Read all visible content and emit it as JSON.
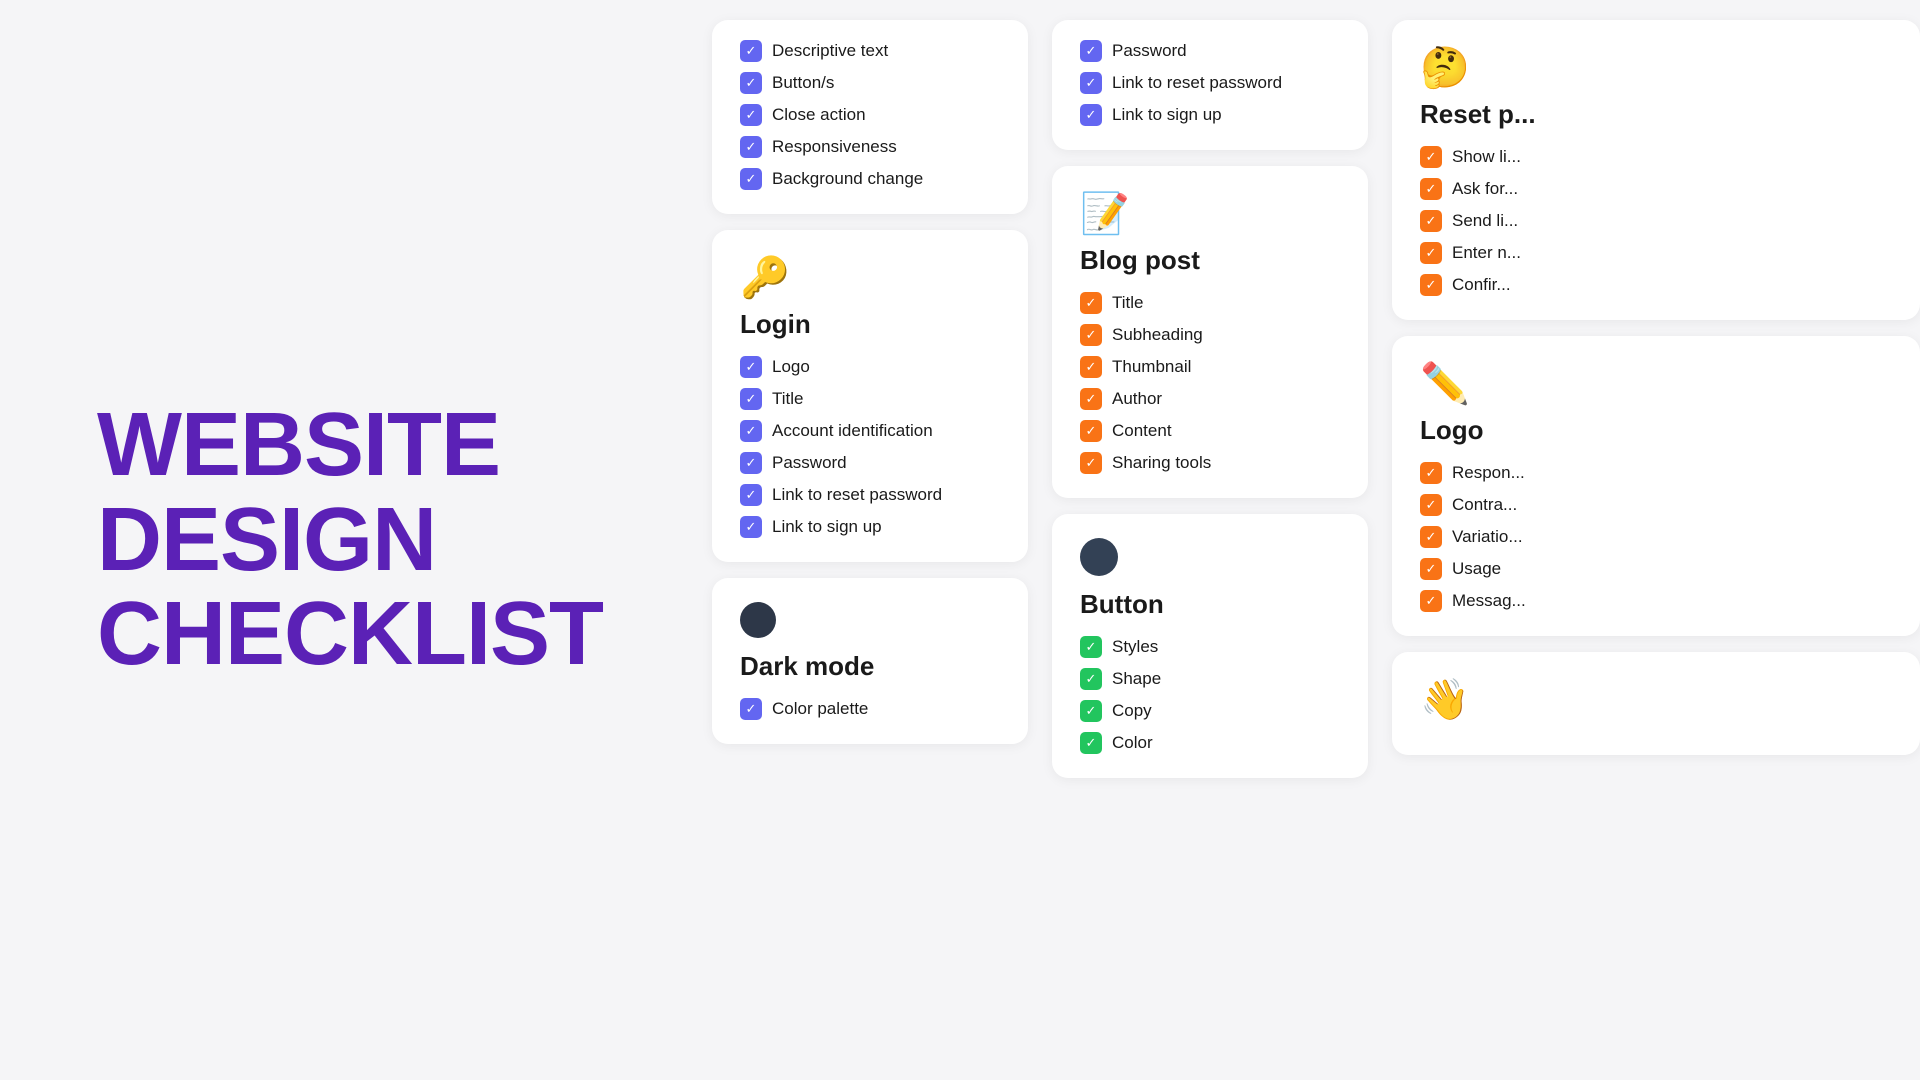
{
  "title": {
    "line1": "WEBSITE",
    "line2": "DESIGN",
    "line3": "CHECKLIST"
  },
  "col1_top_card": {
    "items": [
      {
        "label": "Descriptive text",
        "type": "blue"
      },
      {
        "label": "Button/s",
        "type": "blue"
      },
      {
        "label": "Close action",
        "type": "blue"
      },
      {
        "label": "Responsiveness",
        "type": "blue"
      },
      {
        "label": "Background change",
        "type": "blue"
      }
    ]
  },
  "login_card": {
    "emoji": "🔑",
    "title": "Login",
    "items": [
      {
        "label": "Logo",
        "type": "blue"
      },
      {
        "label": "Title",
        "type": "blue"
      },
      {
        "label": "Account identification",
        "type": "blue"
      },
      {
        "label": "Password",
        "type": "blue"
      },
      {
        "label": "Link to reset password",
        "type": "blue"
      },
      {
        "label": "Link to sign up",
        "type": "blue"
      }
    ]
  },
  "dark_mode_card": {
    "emoji": "⚫",
    "title": "Dark mode",
    "items": [
      {
        "label": "Color palette",
        "type": "blue"
      }
    ]
  },
  "col2_top_card": {
    "items": [
      {
        "label": "Password",
        "type": "blue"
      },
      {
        "label": "Link to reset password",
        "type": "blue"
      },
      {
        "label": "Link to sign up",
        "type": "blue"
      }
    ]
  },
  "blog_post_card": {
    "emoji": "📝",
    "title": "Blog post",
    "items": [
      {
        "label": "Title",
        "type": "orange"
      },
      {
        "label": "Subheading",
        "type": "orange"
      },
      {
        "label": "Thumbnail",
        "type": "orange"
      },
      {
        "label": "Author",
        "type": "orange"
      },
      {
        "label": "Content",
        "type": "orange"
      },
      {
        "label": "Sharing tools",
        "type": "orange"
      }
    ]
  },
  "button_card": {
    "emoji": "🔵",
    "title": "Button",
    "items": [
      {
        "label": "Styles",
        "type": "green"
      },
      {
        "label": "Shape",
        "type": "green"
      },
      {
        "label": "Copy",
        "type": "green"
      },
      {
        "label": "Color",
        "type": "green"
      }
    ]
  },
  "reset_password_card": {
    "emoji": "🤔",
    "title": "Reset p...",
    "items": [
      {
        "label": "Show li...",
        "type": "orange"
      },
      {
        "label": "Ask for...",
        "type": "orange"
      },
      {
        "label": "Send li...",
        "type": "orange"
      },
      {
        "label": "Enter n...",
        "type": "orange"
      },
      {
        "label": "Confir...",
        "type": "orange"
      }
    ]
  },
  "logo_card": {
    "emoji": "✏️",
    "title": "Logo",
    "items": [
      {
        "label": "Respon...",
        "type": "orange"
      },
      {
        "label": "Contra...",
        "type": "orange"
      },
      {
        "label": "Variatio...",
        "type": "orange"
      },
      {
        "label": "Usage",
        "type": "orange"
      },
      {
        "label": "Messag...",
        "type": "orange"
      }
    ]
  },
  "waving_card": {
    "emoji": "👋"
  },
  "checkmark": "✓"
}
